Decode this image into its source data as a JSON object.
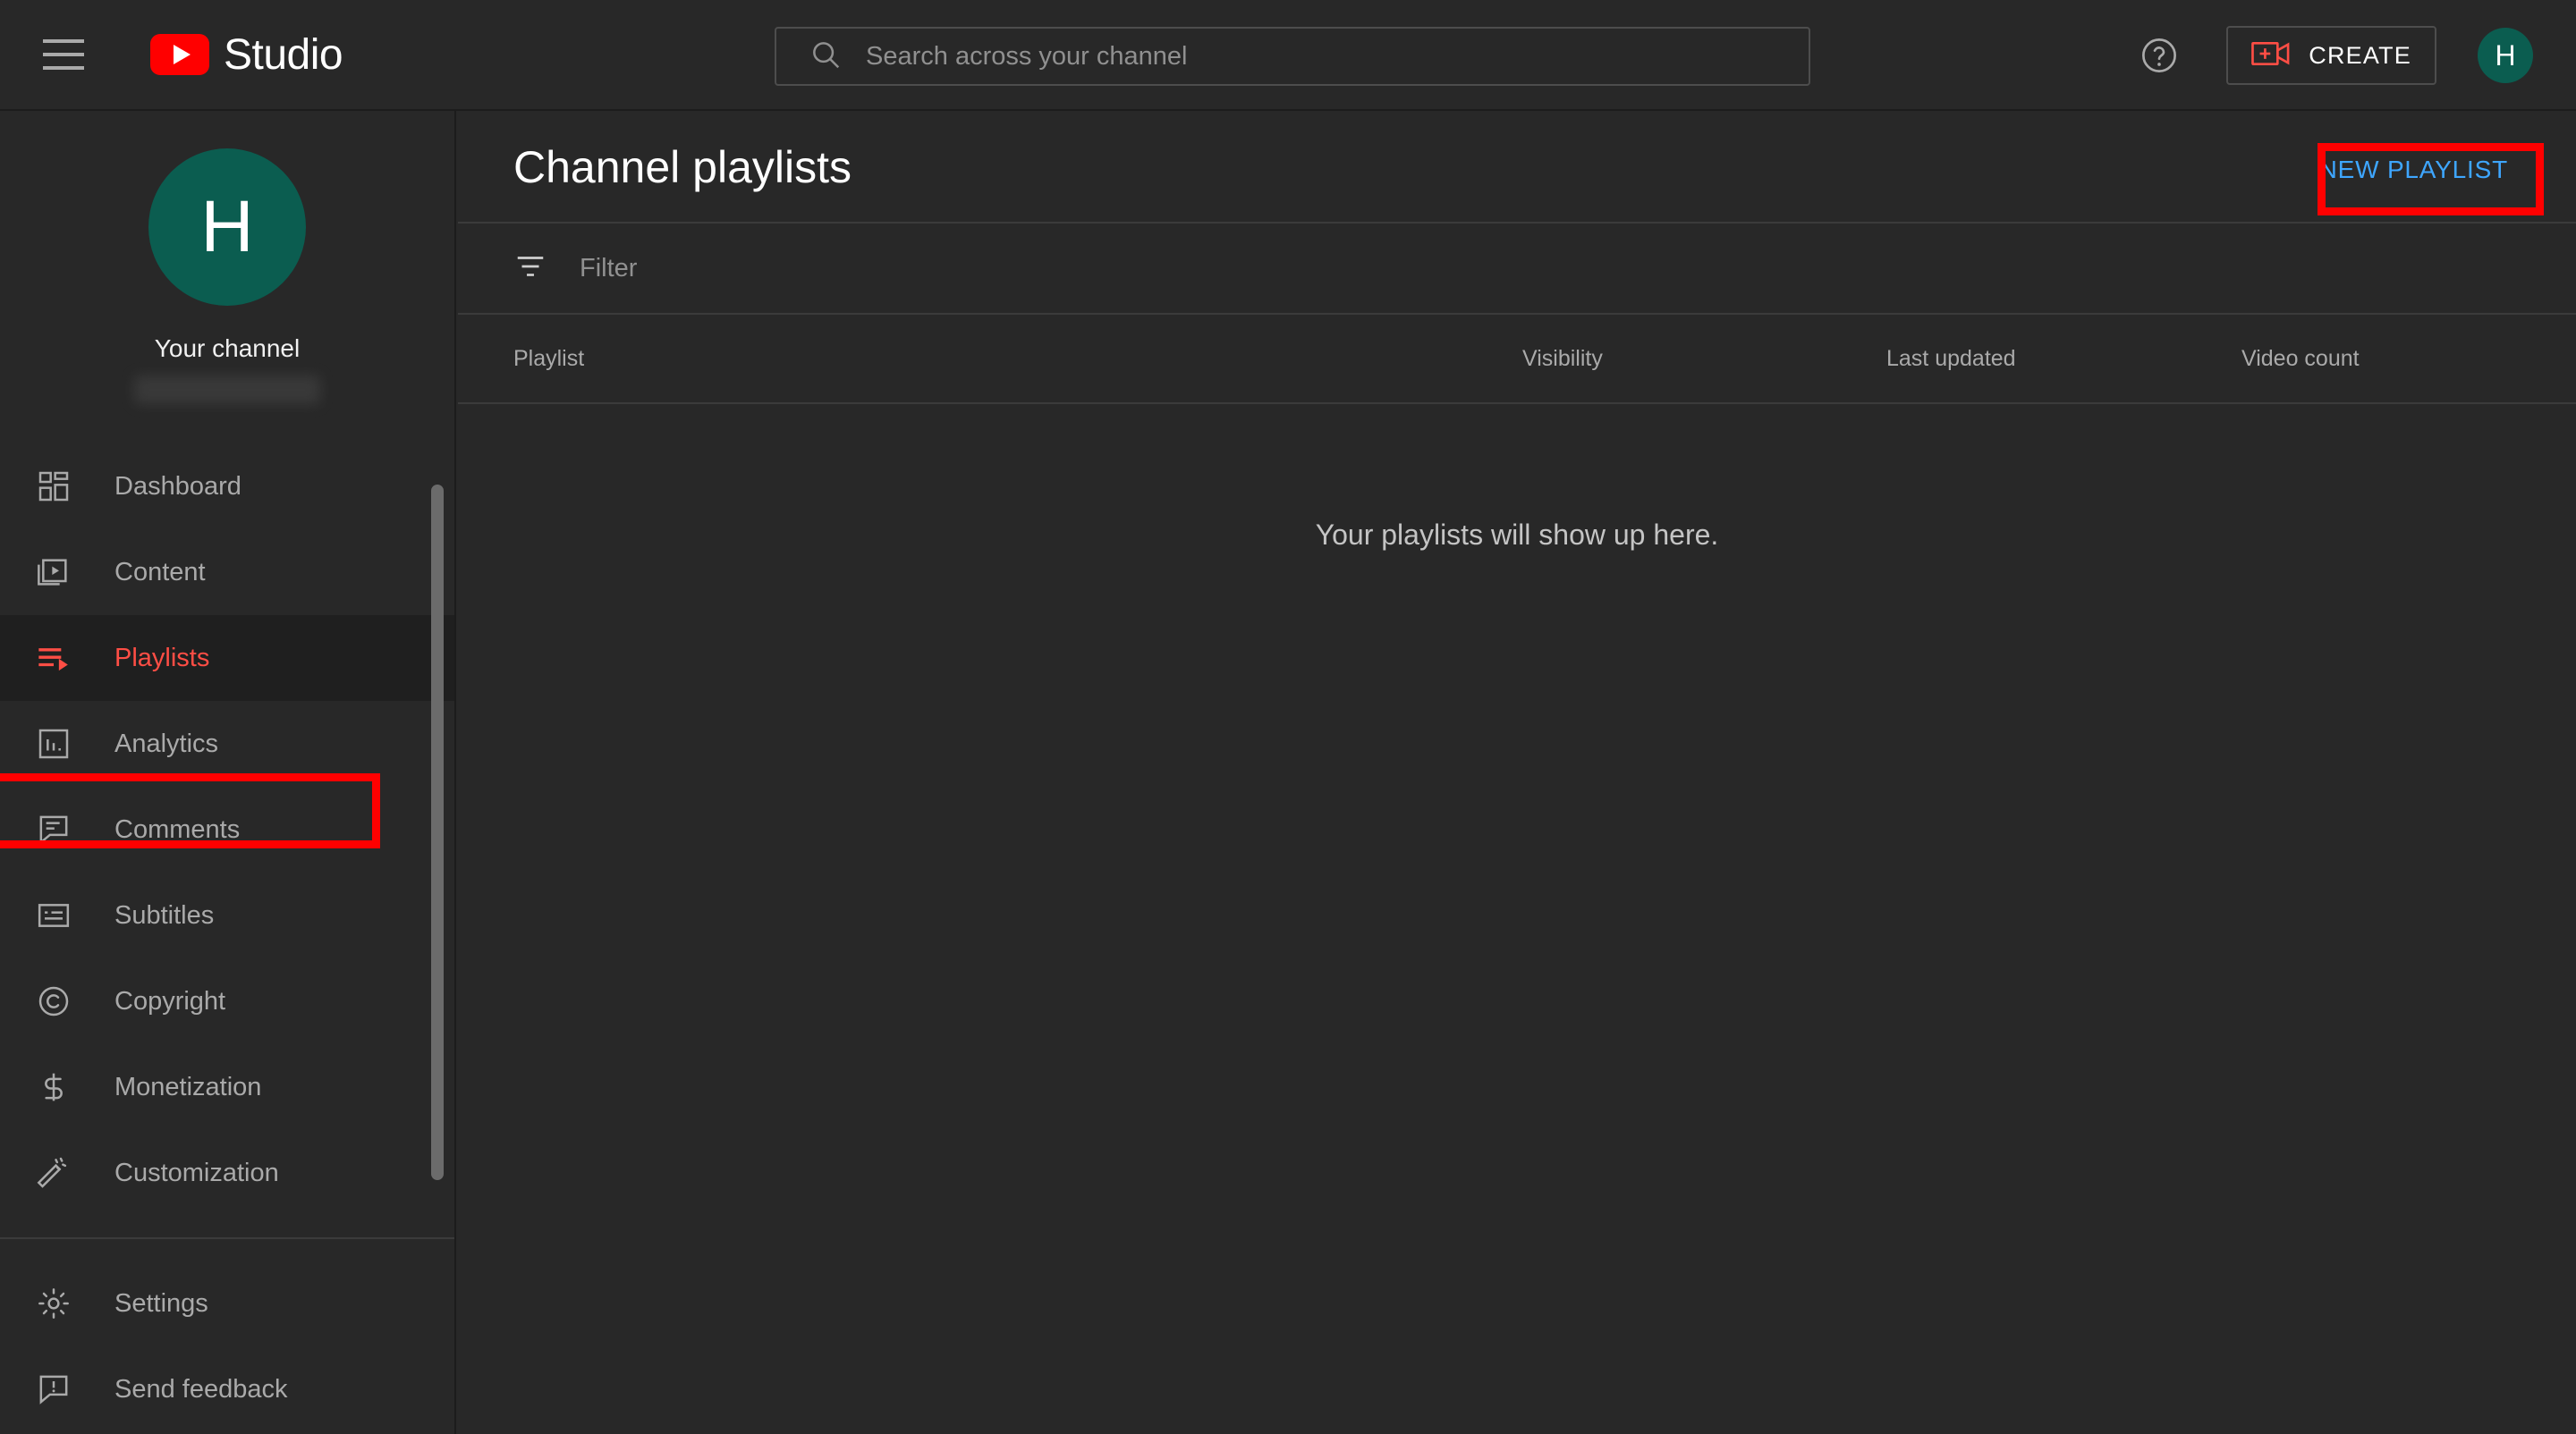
{
  "topbar": {
    "menu_icon": "hamburger-menu-icon",
    "logo_text": "Studio",
    "search": {
      "placeholder": "Search across your channel",
      "value": "",
      "icon": "search-icon"
    },
    "help_icon": "help-circle-icon",
    "create_label": "CREATE",
    "create_icon": "video-plus-icon",
    "avatar_initial": "H"
  },
  "sidebar": {
    "avatar_initial": "H",
    "your_channel_label": "Your channel",
    "channel_name_redacted": "",
    "items": [
      {
        "label": "Dashboard",
        "icon": "dashboard-grid-icon",
        "active": false
      },
      {
        "label": "Content",
        "icon": "content-video-icon",
        "active": false
      },
      {
        "label": "Playlists",
        "icon": "playlists-icon",
        "active": true
      },
      {
        "label": "Analytics",
        "icon": "analytics-bar-chart-icon",
        "active": false
      },
      {
        "label": "Comments",
        "icon": "comments-bubble-icon",
        "active": false
      },
      {
        "label": "Subtitles",
        "icon": "subtitles-icon",
        "active": false
      },
      {
        "label": "Copyright",
        "icon": "copyright-icon",
        "active": false
      },
      {
        "label": "Monetization",
        "icon": "dollar-sign-icon",
        "active": false
      },
      {
        "label": "Customization",
        "icon": "magic-wand-icon",
        "active": false
      }
    ],
    "footer_items": [
      {
        "label": "Settings",
        "icon": "gear-icon"
      },
      {
        "label": "Send feedback",
        "icon": "feedback-exclamation-icon"
      }
    ]
  },
  "main": {
    "page_title": "Channel playlists",
    "new_playlist_label": "NEW PLAYLIST",
    "filter": {
      "placeholder": "Filter",
      "value": "",
      "icon": "filter-icon"
    },
    "table": {
      "columns": [
        "Playlist",
        "Visibility",
        "Last updated",
        "Video count"
      ],
      "rows": [],
      "empty_message": "Your playlists will show up here."
    }
  },
  "colors": {
    "background": "#282828",
    "active_nav": "#ff4e45",
    "active_nav_bg": "#1f1f1f",
    "link_blue": "#3ea6ff",
    "brand_red": "#ff0000",
    "avatar_teal": "#0b5d50",
    "annotation_red": "#ff0000",
    "divider": "#3b3b3b",
    "muted_text": "#aaaaaa"
  }
}
